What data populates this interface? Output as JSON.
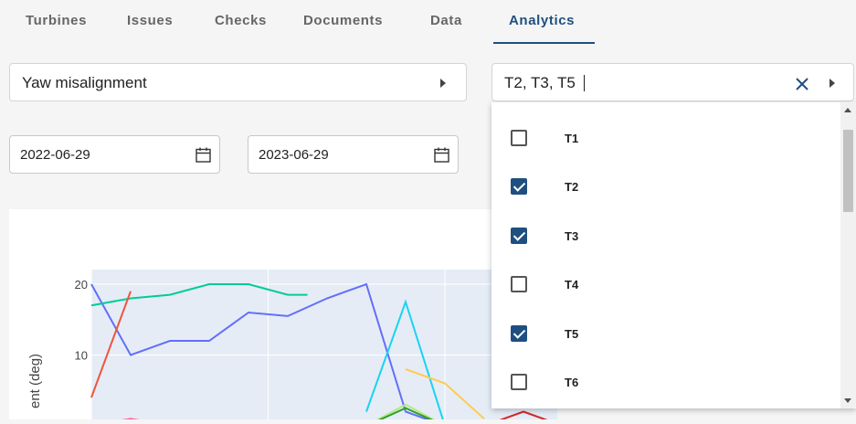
{
  "tabs": [
    {
      "label": "Turbines"
    },
    {
      "label": "Issues"
    },
    {
      "label": "Checks"
    },
    {
      "label": "Documents"
    },
    {
      "label": "Data"
    },
    {
      "label": "Analytics",
      "active": true
    }
  ],
  "metric_select": {
    "value": "Yaw misalignment"
  },
  "turbine_select": {
    "value": "T2, T3, T5"
  },
  "date_range": {
    "start": "2022-06-29",
    "end": "2023-06-29"
  },
  "turbine_options": [
    {
      "label": "T1",
      "checked": false
    },
    {
      "label": "T2",
      "checked": true
    },
    {
      "label": "T3",
      "checked": true
    },
    {
      "label": "T4",
      "checked": false
    },
    {
      "label": "T5",
      "checked": true
    },
    {
      "label": "T6",
      "checked": false
    }
  ],
  "colors": {
    "accent": "#1f4f80",
    "plot_bg": "#e5ecf6"
  },
  "chart_data": {
    "type": "line",
    "ylabel": "ent (deg)",
    "yticks": [
      10,
      20
    ],
    "series": [
      {
        "color": "#636efa",
        "points": [
          [
            0,
            20
          ],
          [
            1,
            10
          ],
          [
            2,
            12
          ],
          [
            3,
            12
          ],
          [
            4,
            16
          ],
          [
            5,
            15.5
          ],
          [
            6,
            18
          ],
          [
            7,
            20
          ],
          [
            8,
            2
          ],
          [
            9,
            0
          ]
        ]
      },
      {
        "color": "#00cc96",
        "points": [
          [
            0,
            17
          ],
          [
            1,
            18
          ],
          [
            2,
            18.5
          ],
          [
            3,
            20
          ],
          [
            4,
            20
          ],
          [
            5,
            18.5
          ],
          [
            5.5,
            18.5
          ]
        ]
      },
      {
        "color": "#ef553b",
        "points": [
          [
            0,
            4
          ],
          [
            1,
            19
          ]
        ]
      },
      {
        "color": "#19d3f3",
        "points": [
          [
            7,
            2
          ],
          [
            8,
            17.5
          ],
          [
            9,
            0
          ]
        ]
      },
      {
        "color": "#fecb52",
        "points": [
          [
            8,
            8
          ],
          [
            9,
            6
          ],
          [
            10,
            1
          ]
        ]
      },
      {
        "color": "#ff6692",
        "points": [
          [
            0,
            0
          ],
          [
            1,
            1
          ],
          [
            2,
            0
          ]
        ]
      },
      {
        "color": "#b6e880",
        "points": [
          [
            7,
            0
          ],
          [
            8,
            3
          ],
          [
            9,
            0
          ]
        ]
      },
      {
        "color": "#2ca02c",
        "points": [
          [
            7,
            0
          ],
          [
            8,
            2.5
          ],
          [
            9,
            0
          ]
        ]
      },
      {
        "color": "#d62728",
        "points": [
          [
            10,
            0
          ],
          [
            11,
            2
          ],
          [
            12,
            0
          ]
        ]
      }
    ]
  }
}
